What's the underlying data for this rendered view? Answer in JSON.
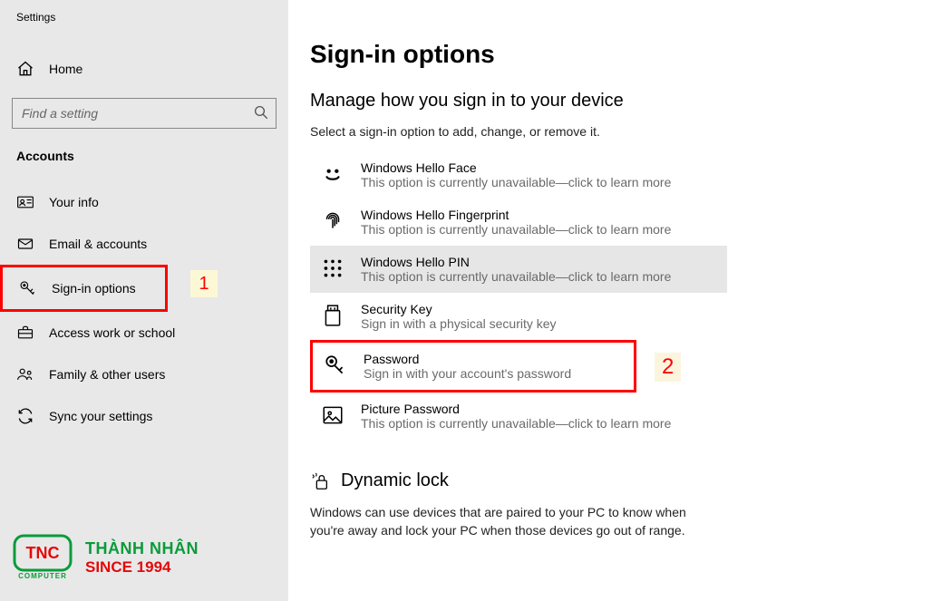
{
  "window": {
    "title": "Settings"
  },
  "sidebar": {
    "home": "Home",
    "search_placeholder": "Find a setting",
    "section": "Accounts",
    "items": [
      {
        "label": "Your info"
      },
      {
        "label": "Email & accounts"
      },
      {
        "label": "Sign-in options"
      },
      {
        "label": "Access work or school"
      },
      {
        "label": "Family & other users"
      },
      {
        "label": "Sync your settings"
      }
    ]
  },
  "annotations": {
    "one": "1",
    "two": "2"
  },
  "logo": {
    "box": "TNC",
    "sub": "COMPUTER",
    "line1": "THÀNH NHÂN",
    "line2": "SINCE 1994"
  },
  "main": {
    "title": "Sign-in options",
    "subtitle": "Manage how you sign in to your device",
    "instruction": "Select a sign-in option to add, change, or remove it.",
    "options": [
      {
        "title": "Windows Hello Face",
        "desc": "This option is currently unavailable—click to learn more"
      },
      {
        "title": "Windows Hello Fingerprint",
        "desc": "This option is currently unavailable—click to learn more"
      },
      {
        "title": "Windows Hello PIN",
        "desc": "This option is currently unavailable—click to learn more"
      },
      {
        "title": "Security Key",
        "desc": "Sign in with a physical security key"
      },
      {
        "title": "Password",
        "desc": "Sign in with your account's password"
      },
      {
        "title": "Picture Password",
        "desc": "This option is currently unavailable—click to learn more"
      }
    ],
    "dynamic_lock": {
      "title": "Dynamic lock",
      "desc": "Windows can use devices that are paired to your PC to know when you're away and lock your PC when those devices go out of range."
    }
  }
}
